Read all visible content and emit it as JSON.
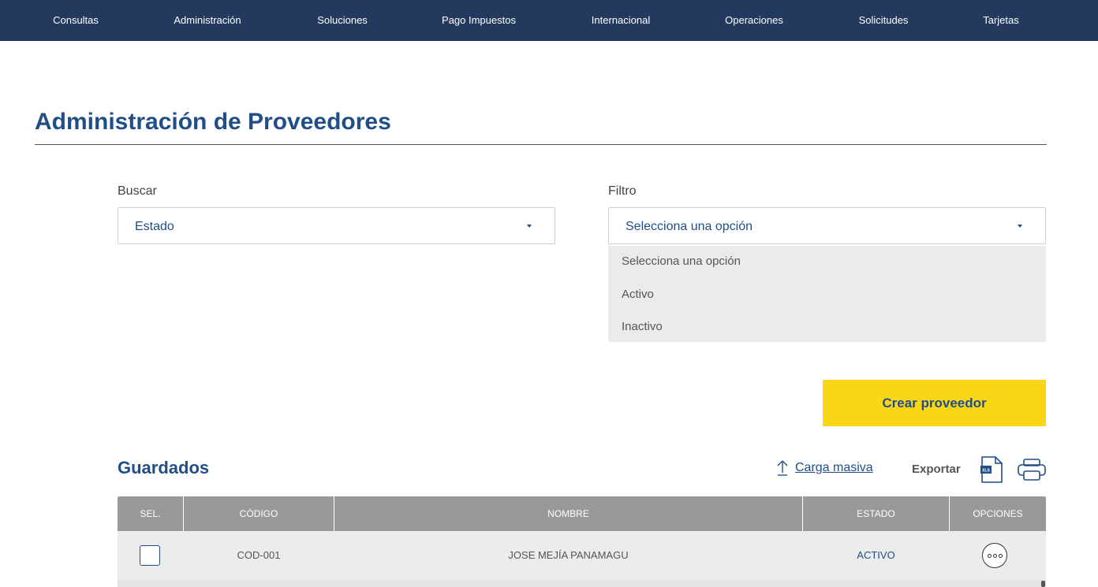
{
  "nav": {
    "items": [
      "Consultas",
      "Administración",
      "Soluciones",
      "Pago Impuestos",
      "Internacional",
      "Operaciones",
      "Solicitudes",
      "Tarjetas"
    ]
  },
  "page": {
    "title": "Administración de Proveedores"
  },
  "search": {
    "label": "Buscar",
    "value": "Estado"
  },
  "filter": {
    "label": "Filtro",
    "value": "Selecciona una opción",
    "options": [
      "Selecciona una opción",
      "Activo",
      "Inactivo"
    ]
  },
  "actions": {
    "create_label": "Crear proveedor"
  },
  "saved": {
    "title": "Guardados",
    "bulk_upload_label": "Carga masiva",
    "export_label": "Exportar",
    "xls_badge": "XLS"
  },
  "table": {
    "headers": [
      "SEL.",
      "CÓDIGO",
      "NOMBRE",
      "ESTADO",
      "OPCIONES"
    ],
    "rows": [
      {
        "code": "COD-001",
        "name": "JOSE MEJÍA PANAMAGU",
        "status": "ACTIVO"
      }
    ]
  },
  "colors": {
    "nav_bg": "#233a5e",
    "brand_blue": "#1f4e88",
    "accent_yellow": "#fbd616",
    "table_header_bg": "#999999"
  },
  "icons": {
    "bulk_upload": "upload-arrow-icon",
    "export_xls": "xls-file-icon",
    "print": "printer-icon",
    "row_options": "more-options-icon",
    "dropdown": "caret-down-icon"
  }
}
